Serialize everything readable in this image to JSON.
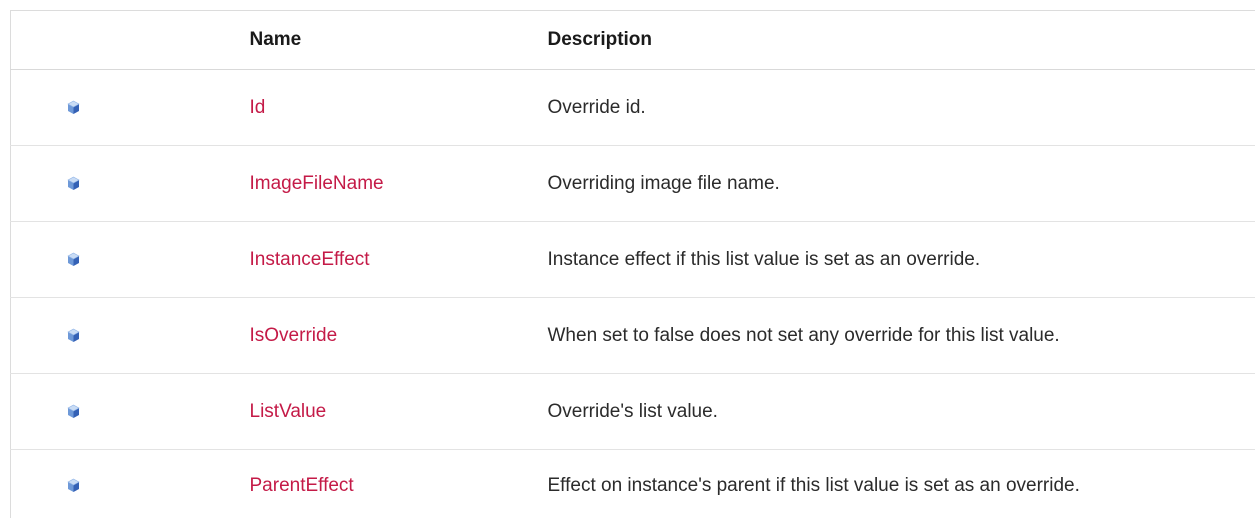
{
  "table": {
    "headers": {
      "icon": "",
      "name": "Name",
      "description": "Description"
    },
    "rows": [
      {
        "icon": "public-property-icon",
        "name": "Id",
        "description": "Override id."
      },
      {
        "icon": "public-property-icon",
        "name": "ImageFileName",
        "description": "Overriding image file name."
      },
      {
        "icon": "public-property-icon",
        "name": "InstanceEffect",
        "description": "Instance effect if this list value is set as an override."
      },
      {
        "icon": "public-property-icon",
        "name": "IsOverride",
        "description": "When set to false does not set any override for this list value."
      },
      {
        "icon": "public-property-icon",
        "name": "ListValue",
        "description": "Override's list value."
      },
      {
        "icon": "public-property-icon",
        "name": "ParentEffect",
        "description": "Effect on instance's parent if this list value is set as an override."
      }
    ]
  },
  "colors": {
    "link": "#c41a47",
    "border": "#e3e3e3",
    "icon_light": "#9fc4ee",
    "icon_dark": "#3461b5"
  }
}
